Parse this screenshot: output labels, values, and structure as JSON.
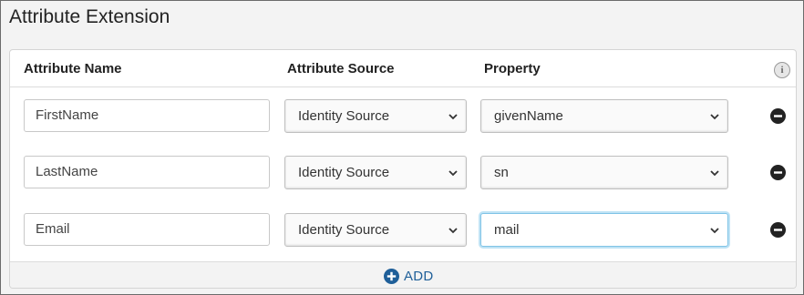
{
  "title": "Attribute Extension",
  "columns": {
    "name": "Attribute Name",
    "source": "Attribute Source",
    "property": "Property"
  },
  "info_icon": {
    "glyph": "i",
    "name": "info-icon"
  },
  "rows": [
    {
      "name": "FirstName",
      "source": "Identity Source",
      "property": "givenName",
      "focused": false
    },
    {
      "name": "LastName",
      "source": "Identity Source",
      "property": "sn",
      "focused": false
    },
    {
      "name": "Email",
      "source": "Identity Source",
      "property": "mail",
      "focused": true
    }
  ],
  "add_label": "ADD",
  "colors": {
    "accent": "#1f5f99",
    "focus": "#7fc3e6",
    "remove": "#222222"
  }
}
